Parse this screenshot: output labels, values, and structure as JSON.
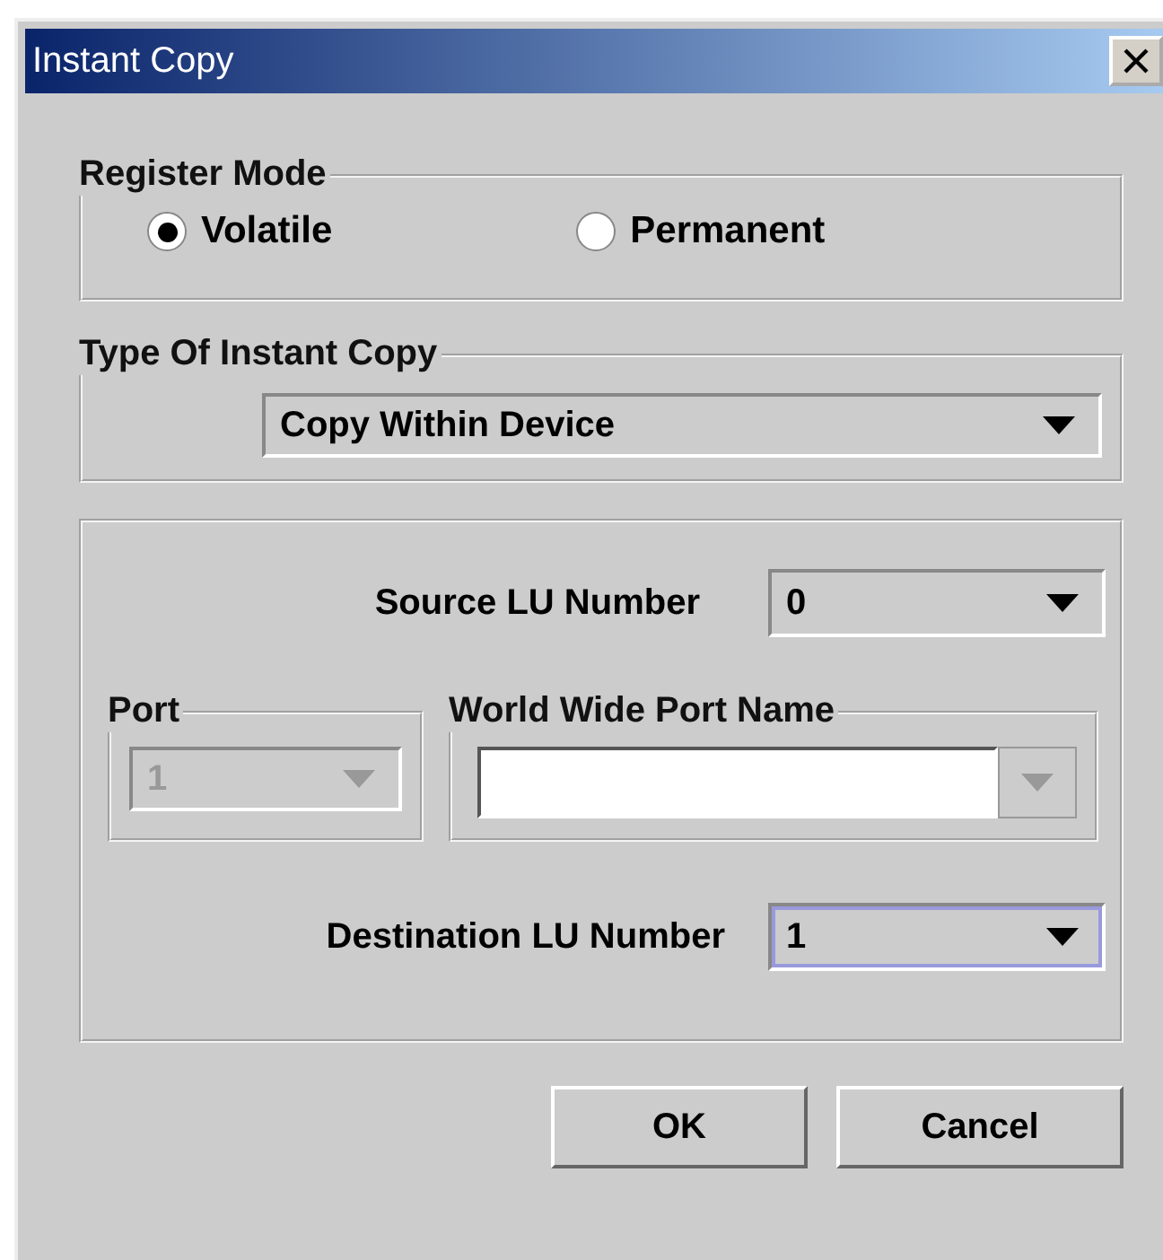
{
  "window": {
    "title": "Instant Copy"
  },
  "register_mode": {
    "label": "Register Mode",
    "options": [
      {
        "label": "Volatile",
        "selected": true
      },
      {
        "label": "Permanent",
        "selected": false
      }
    ]
  },
  "type_of_instant_copy": {
    "label": "Type Of Instant Copy",
    "value": "Copy Within Device"
  },
  "source_lu": {
    "label": "Source LU Number",
    "value": "0"
  },
  "port": {
    "label": "Port",
    "value": "1",
    "disabled": true
  },
  "world_wide_port_name": {
    "label": "World Wide Port Name",
    "arrow_disabled": true
  },
  "destination_lu": {
    "label": "Destination LU Number",
    "value": "1",
    "focused": true
  },
  "buttons": [
    "OK",
    "Cancel"
  ]
}
